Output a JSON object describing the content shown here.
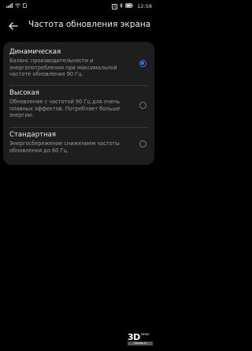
{
  "status_bar": {
    "left_icons": [
      "signal-icon",
      "wifi-icon",
      "sim-icon"
    ],
    "nfc_label": "N",
    "time": "12:58"
  },
  "header": {
    "title": "Частота обновления экрана"
  },
  "options": [
    {
      "title": "Динамическая",
      "description": "Баланс производительности и энергопотребления при максимальной частоте обновления 90 Гц.",
      "selected": true
    },
    {
      "title": "Высокая",
      "description": "Обновление с частотой 90 Гц для очень плавных эффектов. Потребляет больше энергии.",
      "selected": false
    },
    {
      "title": "Стандартная",
      "description": "Энергосбережение снижением частоты обновления до 60 Гц.",
      "selected": false
    }
  ],
  "watermark": {
    "big": "3D",
    "small": "NEWS",
    "bar": "3dnews.ru"
  },
  "colors": {
    "background": "#000000",
    "card": "#1e1e1e",
    "accent": "#3a7bd5"
  }
}
